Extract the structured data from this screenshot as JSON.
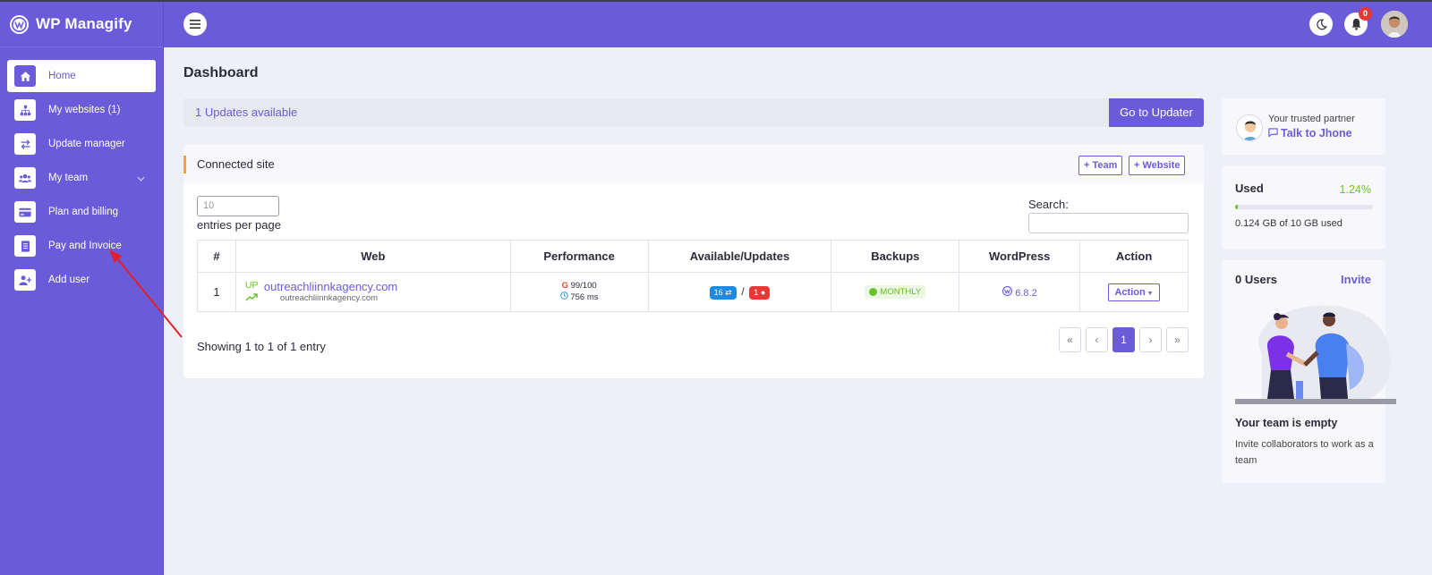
{
  "app": {
    "brand": "WP Managify"
  },
  "sidebar": {
    "items": [
      {
        "label": "Home",
        "icon": "home-icon",
        "active": true
      },
      {
        "label": "My websites (1)",
        "icon": "sitemap-icon"
      },
      {
        "label": "Update manager",
        "icon": "exchange-icon"
      },
      {
        "label": "My team",
        "icon": "users-icon",
        "has_submenu": true
      },
      {
        "label": "Plan and billing",
        "icon": "credit-card-icon"
      },
      {
        "label": "Pay and Invoice",
        "icon": "invoice-icon"
      },
      {
        "label": "Add user",
        "icon": "user-plus-icon"
      }
    ]
  },
  "header": {
    "notifications_count": "0"
  },
  "main": {
    "title": "Dashboard",
    "updates_text": "1 Updates available",
    "updater_button": "Go to Updater",
    "connected": {
      "title": "Connected site",
      "team_button": "Team",
      "website_button": "Website",
      "entries_placeholder": "10",
      "entries_label": "entries per page",
      "search_label": "Search:",
      "columns": [
        "#",
        "Web",
        "Performance",
        "Available/Updates",
        "Backups",
        "WordPress",
        "Action"
      ],
      "rows": [
        {
          "num": "1",
          "status": "UP",
          "site": "outreachliinnkagency.com",
          "site_sub": "outreachliinnkagency.com",
          "score": "99/100",
          "time": "756 ms",
          "available": "16",
          "updates": "1",
          "backup": "MONTHLY",
          "wp_version": "6.8.2",
          "action": "Action"
        }
      ],
      "showing": "Showing 1 to 1 of 1 entry",
      "pager": [
        "«",
        "‹",
        "1",
        "›",
        "»"
      ]
    }
  },
  "right": {
    "partner_label": "Your trusted partner",
    "partner_link": "Talk to Jhone",
    "used_title": "Used",
    "used_percent": "1.24%",
    "used_fraction": 0.0124,
    "used_text": "0.124 GB of 10 GB used",
    "users_title": "0 Users",
    "invite": "Invite",
    "team_empty": "Your team is empty",
    "team_desc": "Invite collaborators to work as a team"
  },
  "colors": {
    "primary": "#6a5cd9",
    "success": "#6cc22b",
    "danger": "#e53935",
    "info": "#1e88e5",
    "accent": "#f5a623"
  }
}
